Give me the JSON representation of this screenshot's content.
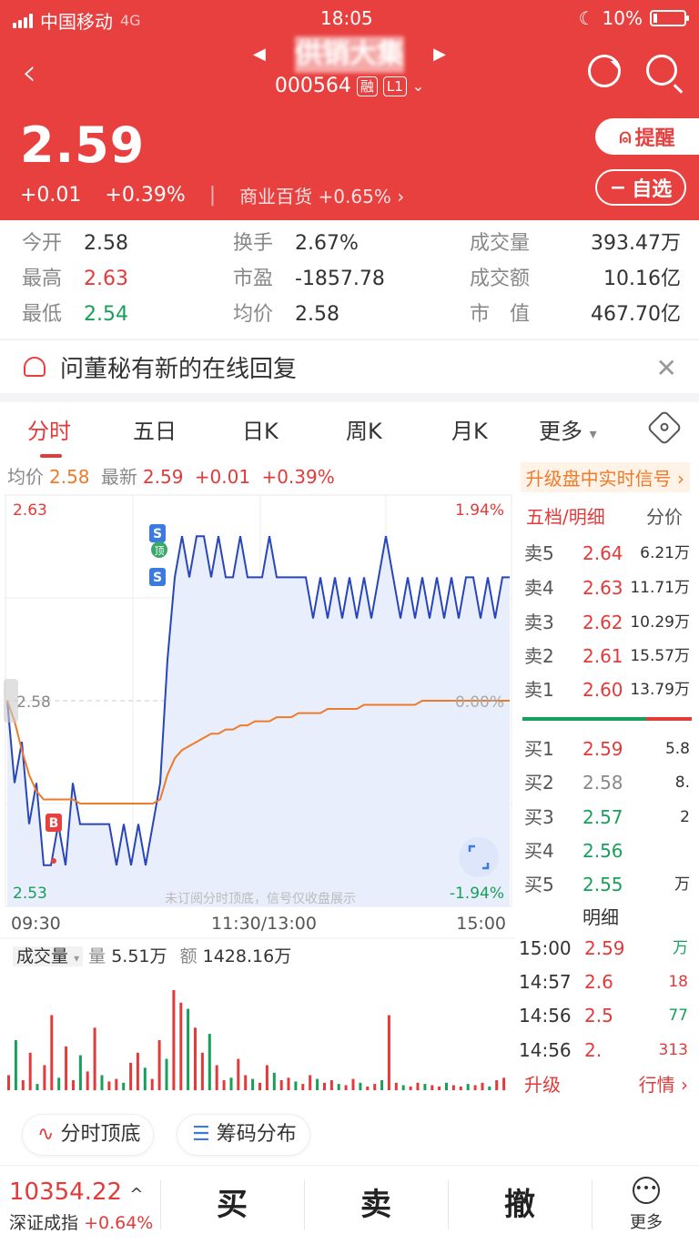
{
  "status": {
    "carrier": "中国移动",
    "network": "4G",
    "time": "18:05",
    "battery": "10%"
  },
  "stock": {
    "name": "供销大集",
    "code": "000564",
    "tag_margin": "融",
    "tag_level": "L1",
    "price": "2.59",
    "change": "+0.01",
    "change_pct": "+0.39%",
    "industry": "商业百货",
    "industry_pct": "+0.65%"
  },
  "buttons": {
    "remind": "提醒",
    "watchlist": "自选"
  },
  "stats": {
    "open_k": "今开",
    "open_v": "2.58",
    "high_k": "最高",
    "high_v": "2.63",
    "low_k": "最低",
    "low_v": "2.54",
    "turnover_k": "换手",
    "turnover_v": "2.67%",
    "pe_k": "市盈",
    "pe_v": "-1857.78",
    "avg_k": "均价",
    "avg_v": "2.58",
    "vol_k": "成交量",
    "vol_v": "393.47万",
    "amt_k": "成交额",
    "amt_v": "10.16亿",
    "mcap_k": "市　值",
    "mcap_v": "467.70亿"
  },
  "notice": {
    "text": "问董秘有新的在线回复"
  },
  "tabs": [
    "分时",
    "五日",
    "日K",
    "周K",
    "月K",
    "更多"
  ],
  "avgline": {
    "avg_label": "均价",
    "avg": "2.58",
    "latest_label": "最新",
    "latest": "2.59",
    "chg": "+0.01",
    "pct": "+0.39%",
    "upgrade": "升级盘中实时信号"
  },
  "chart_data": {
    "type": "line",
    "y_high": "2.63",
    "y_low": "2.53",
    "y_mid": "2.58",
    "pct_high": "1.94%",
    "pct_low": "-1.94%",
    "pct_mid": "0.00%",
    "x_labels": [
      "09:30",
      "11:30/13:00",
      "15:00"
    ],
    "watermark": "未订阅分时顶底，信号仅收盘展示",
    "ylim": [
      2.53,
      2.63
    ],
    "series": [
      {
        "values": [
          2.58,
          2.56,
          2.57,
          2.55,
          2.56,
          2.54,
          2.54,
          2.55,
          2.54,
          2.56,
          2.55,
          2.55,
          2.55,
          2.55,
          2.55,
          2.54,
          2.55,
          2.54,
          2.55,
          2.54,
          2.55,
          2.56,
          2.59,
          2.61,
          2.62,
          2.61,
          2.62,
          2.62,
          2.61,
          2.62,
          2.61,
          2.61,
          2.62,
          2.61,
          2.61,
          2.61,
          2.62,
          2.61,
          2.61,
          2.61,
          2.61,
          2.61,
          2.6,
          2.61,
          2.6,
          2.61,
          2.6,
          2.61,
          2.6,
          2.61,
          2.6,
          2.61,
          2.62,
          2.61,
          2.6,
          2.61,
          2.6,
          2.61,
          2.6,
          2.61,
          2.6,
          2.61,
          2.6,
          2.61,
          2.61,
          2.6,
          2.61,
          2.6,
          2.61,
          2.61
        ]
      },
      {
        "values": [
          2.58,
          2.575,
          2.568,
          2.562,
          2.558,
          2.556,
          2.556,
          2.556,
          2.556,
          2.556,
          2.555,
          2.555,
          2.555,
          2.555,
          2.555,
          2.555,
          2.555,
          2.555,
          2.555,
          2.555,
          2.555,
          2.556,
          2.562,
          2.566,
          2.568,
          2.569,
          2.57,
          2.571,
          2.572,
          2.572,
          2.573,
          2.573,
          2.574,
          2.574,
          2.575,
          2.575,
          2.575,
          2.576,
          2.576,
          2.576,
          2.577,
          2.577,
          2.577,
          2.577,
          2.578,
          2.578,
          2.578,
          2.578,
          2.578,
          2.579,
          2.579,
          2.579,
          2.579,
          2.579,
          2.579,
          2.579,
          2.579,
          2.58,
          2.58,
          2.58,
          2.58,
          2.58,
          2.58,
          2.58,
          2.58,
          2.58,
          2.58,
          2.58,
          2.58,
          2.58
        ]
      }
    ],
    "signals": [
      "S",
      "顶",
      "S",
      "B"
    ],
    "volume": {
      "label": "成交量",
      "vol_label": "量",
      "vol": "5.51万",
      "amt_label": "额",
      "amt": "1428.16万",
      "values": [
        12,
        40,
        8,
        30,
        5,
        20,
        60,
        10,
        35,
        8,
        28,
        15,
        50,
        12,
        7,
        9,
        6,
        22,
        30,
        18,
        9,
        40,
        25,
        80,
        70,
        65,
        50,
        30,
        45,
        20,
        8,
        10,
        25,
        12,
        9,
        6,
        20,
        14,
        8,
        10,
        7,
        5,
        12,
        9,
        6,
        8,
        5,
        4,
        9,
        6,
        3,
        5,
        8,
        60,
        6,
        4,
        3,
        6,
        5,
        4,
        3,
        6,
        4,
        3,
        5,
        4,
        6,
        3,
        8,
        10
      ]
    }
  },
  "orderbook": {
    "title": "五档/明细",
    "title2": "分价",
    "asks": [
      {
        "l": "卖5",
        "p": "2.64",
        "v": "6.21万"
      },
      {
        "l": "卖4",
        "p": "2.63",
        "v": "11.71万"
      },
      {
        "l": "卖3",
        "p": "2.62",
        "v": "10.29万"
      },
      {
        "l": "卖2",
        "p": "2.61",
        "v": "15.57万"
      },
      {
        "l": "卖1",
        "p": "2.60",
        "v": "13.79万"
      }
    ],
    "bids": [
      {
        "l": "买1",
        "p": "2.59",
        "v": "5.8"
      },
      {
        "l": "买2",
        "p": "2.58",
        "v": "8."
      },
      {
        "l": "买3",
        "p": "2.57",
        "v": "2"
      },
      {
        "l": "买4",
        "p": "2.56",
        "v": ""
      },
      {
        "l": "买5",
        "p": "2.55",
        "v": "万"
      }
    ],
    "detail_label": "明细",
    "trades": [
      {
        "t": "15:00",
        "p": "2.59",
        "v": "万"
      },
      {
        "t": "14:57",
        "p": "2.6",
        "v": "18"
      },
      {
        "t": "14:56",
        "p": "2.5",
        "v": "77"
      },
      {
        "t": "14:56",
        "p": "2.",
        "v": "313"
      }
    ],
    "more_left": "升级",
    "more_right": "行情"
  },
  "chips": {
    "chip1": "分时顶底",
    "chip2": "筹码分布"
  },
  "bottom": {
    "index_value": "10354.22",
    "index_name": "深证成指",
    "index_pct": "+0.64%",
    "buy": "买",
    "sell": "卖",
    "cancel": "撤",
    "more": "更多"
  }
}
